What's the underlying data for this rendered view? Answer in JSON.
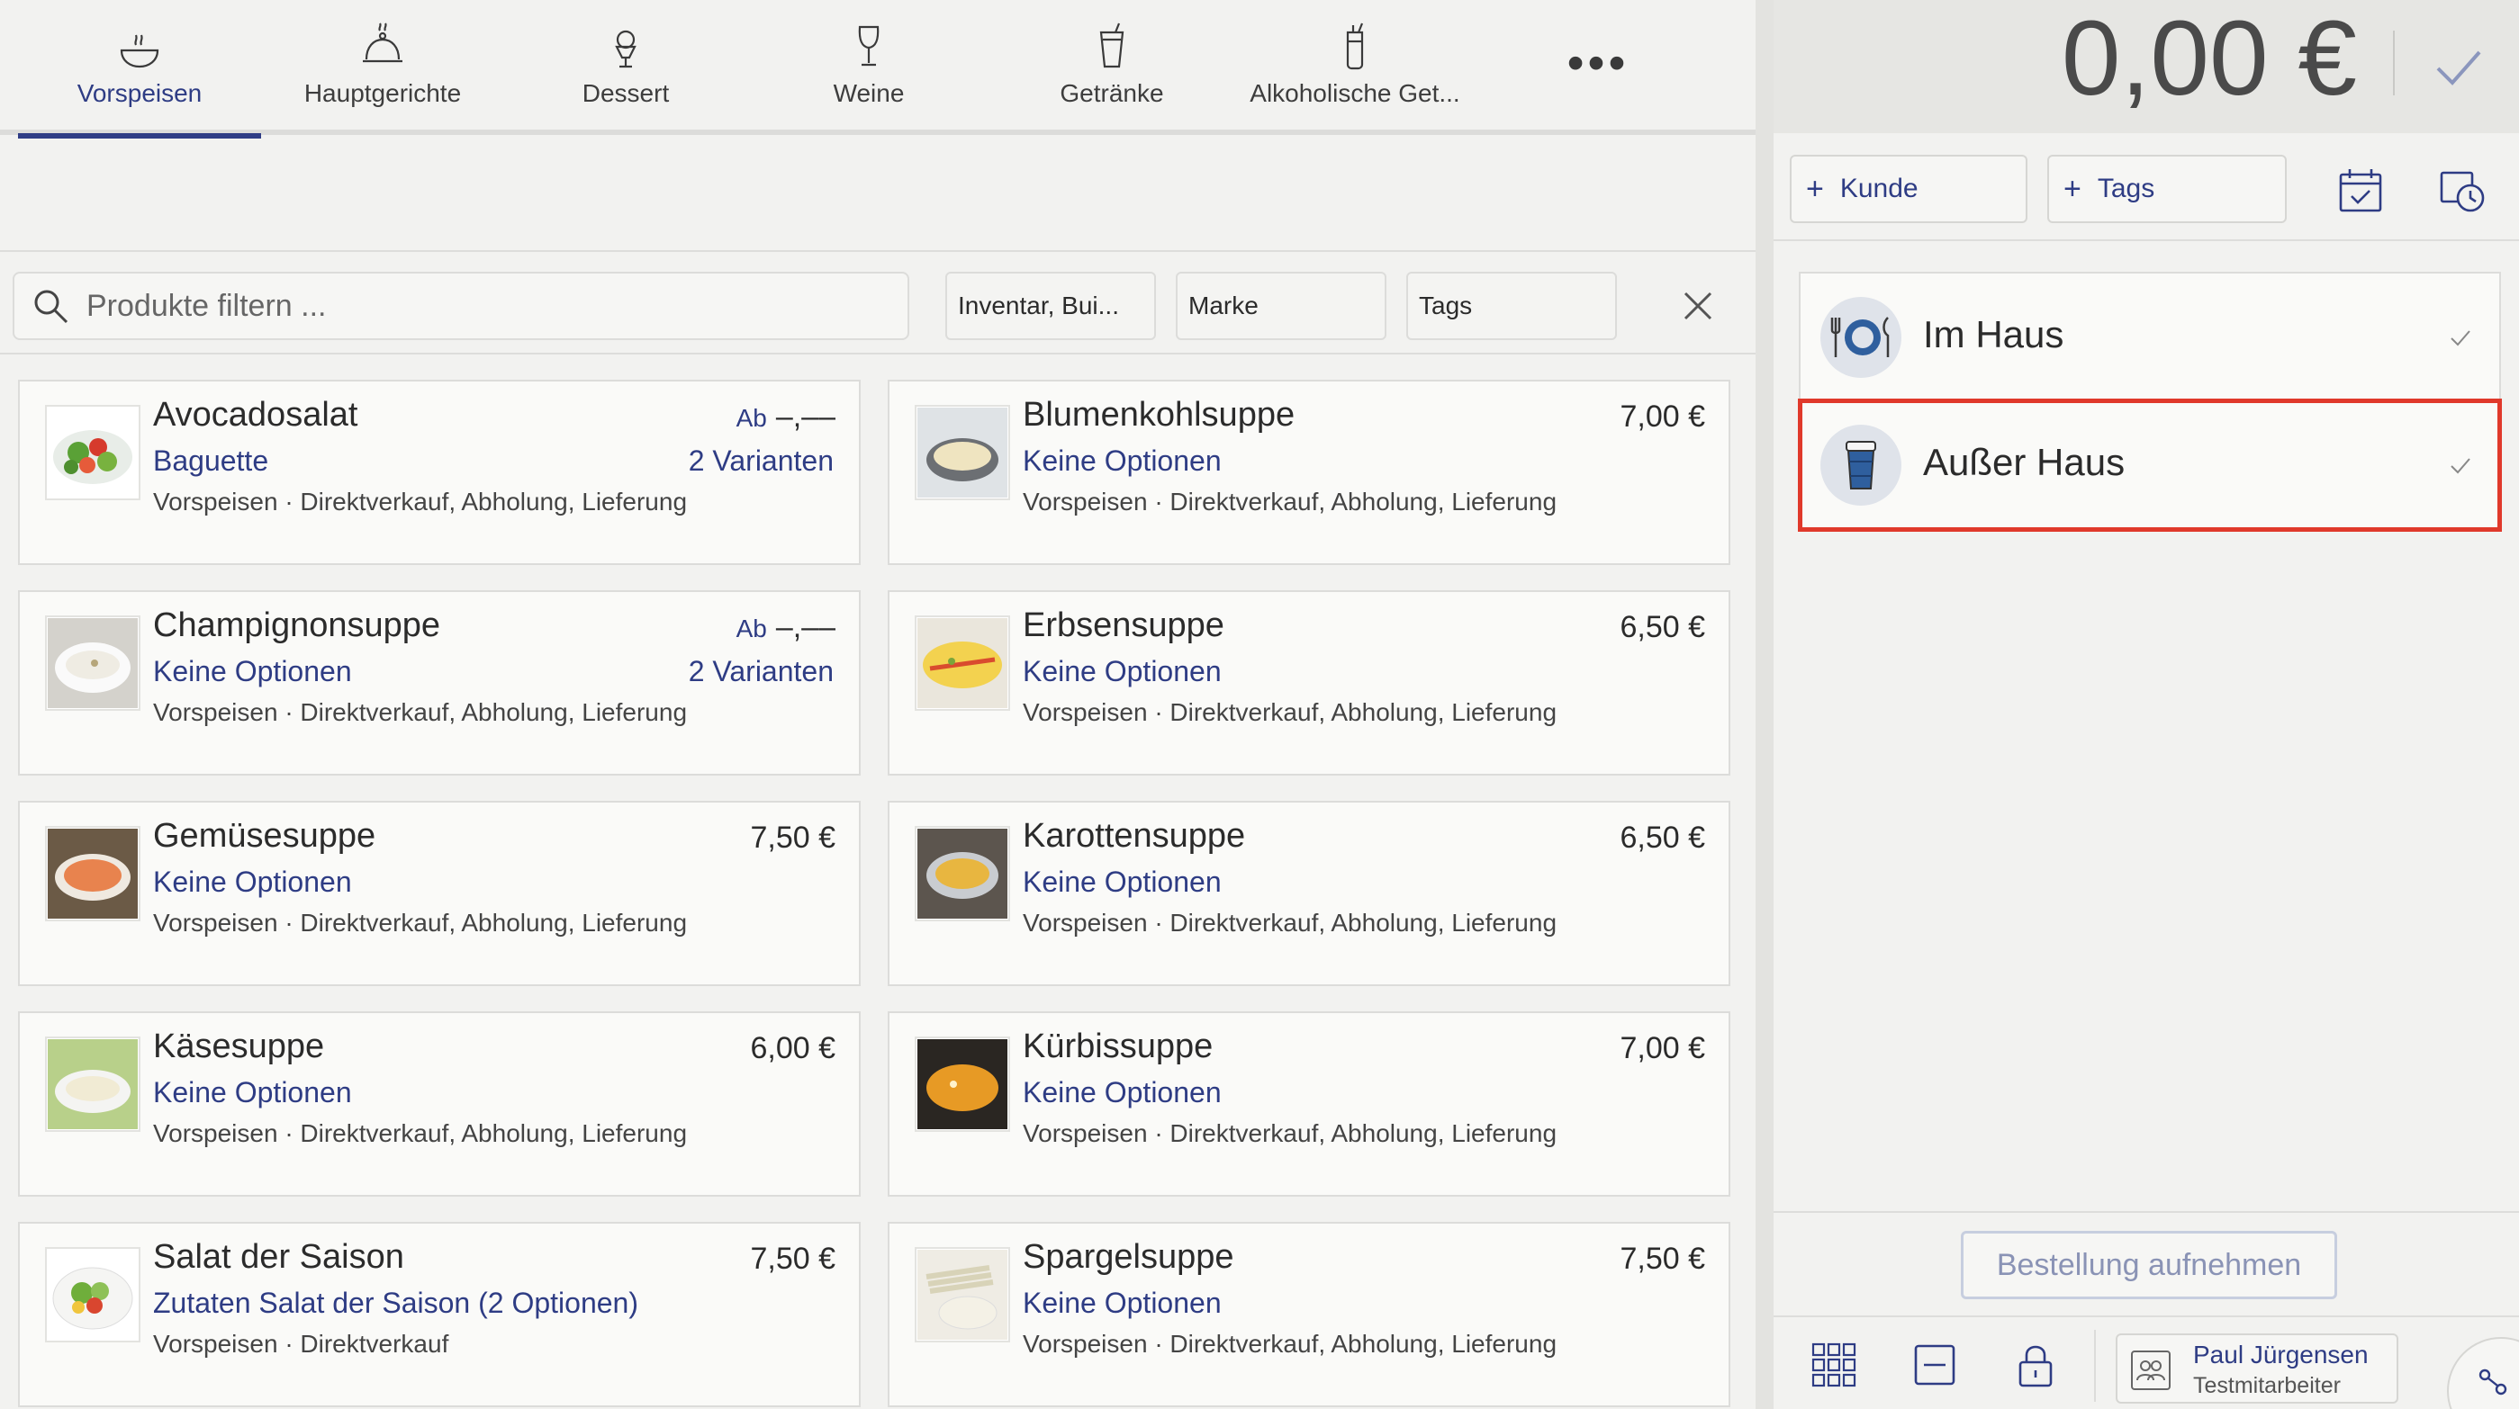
{
  "tabs": [
    {
      "label": "Vorspeisen",
      "icon": "soup-bowl-icon",
      "active": true
    },
    {
      "label": "Hauptgerichte",
      "icon": "cloche-icon",
      "active": false
    },
    {
      "label": "Dessert",
      "icon": "ice-cream-icon",
      "active": false
    },
    {
      "label": "Weine",
      "icon": "wine-glass-icon",
      "active": false
    },
    {
      "label": "Getränke",
      "icon": "cup-icon",
      "active": false
    },
    {
      "label": "Alkoholische Get...",
      "icon": "cocktail-icon",
      "active": false
    }
  ],
  "more_label": "•••",
  "filter": {
    "search_placeholder": "Produkte filtern ...",
    "inventory": "Inventar, Bui...",
    "brand": "Marke",
    "tags": "Tags"
  },
  "products": [
    {
      "name": "Avocadosalat",
      "options": "Baguette",
      "meta": "Vorspeisen · Direktverkauf, Abholung, Lieferung",
      "price_prefix": "Ab",
      "price": "–,––",
      "variants": "2 Varianten",
      "image": "salad"
    },
    {
      "name": "Blumenkohlsuppe",
      "options": "Keine Optionen",
      "meta": "Vorspeisen · Direktverkauf, Abholung, Lieferung",
      "price_prefix": "",
      "price": "7,00 €",
      "variants": "",
      "image": "cream-soup"
    },
    {
      "name": "Champignonsuppe",
      "options": "Keine Optionen",
      "meta": "Vorspeisen · Direktverkauf, Abholung, Lieferung",
      "price_prefix": "Ab",
      "price": "–,––",
      "variants": "2 Varianten",
      "image": "white-soup"
    },
    {
      "name": "Erbsensuppe",
      "options": "Keine Optionen",
      "meta": "Vorspeisen · Direktverkauf, Abholung, Lieferung",
      "price_prefix": "",
      "price": "6,50 €",
      "variants": "",
      "image": "omelette"
    },
    {
      "name": "Gemüsesuppe",
      "options": "Keine Optionen",
      "meta": "Vorspeisen · Direktverkauf, Abholung, Lieferung",
      "price_prefix": "",
      "price": "7,50 €",
      "variants": "",
      "image": "orange-soup"
    },
    {
      "name": "Karottensuppe",
      "options": "Keine Optionen",
      "meta": "Vorspeisen · Direktverkauf, Abholung, Lieferung",
      "price_prefix": "",
      "price": "6,50 €",
      "variants": "",
      "image": "yellow-soup"
    },
    {
      "name": "Käsesuppe",
      "options": "Keine Optionen",
      "meta": "Vorspeisen · Direktverkauf, Abholung, Lieferung",
      "price_prefix": "",
      "price": "6,00 €",
      "variants": "",
      "image": "cheese-soup"
    },
    {
      "name": "Kürbissuppe",
      "options": "Keine Optionen",
      "meta": "Vorspeisen · Direktverkauf, Abholung, Lieferung",
      "price_prefix": "",
      "price": "7,00 €",
      "variants": "",
      "image": "pumpkin-soup"
    },
    {
      "name": "Salat der Saison",
      "options": "Zutaten Salat der Saison (2 Optionen)",
      "meta": "Vorspeisen · Direktverkauf",
      "price_prefix": "",
      "price": "7,50 €",
      "variants": "",
      "image": "green-salad"
    },
    {
      "name": "Spargelsuppe",
      "options": "Keine Optionen",
      "meta": "Vorspeisen · Direktverkauf, Abholung, Lieferung",
      "price_prefix": "",
      "price": "7,50 €",
      "variants": "",
      "image": "asparagus"
    }
  ],
  "order": {
    "total": "0,00 €",
    "customer_label": "Kunde",
    "tags_label": "Tags",
    "dining_options": [
      {
        "label": "Im Haus",
        "icon": "plate-cutlery-icon",
        "highlighted": false
      },
      {
        "label": "Außer Haus",
        "icon": "takeaway-cup-icon",
        "highlighted": true
      }
    ],
    "place_order_label": "Bestellung aufnehmen"
  },
  "user": {
    "name": "Paul Jürgensen",
    "role": "Testmitarbeiter"
  },
  "colors": {
    "accent": "#2e3c84",
    "highlight": "#e0392b",
    "background": "#f2f2f0"
  }
}
